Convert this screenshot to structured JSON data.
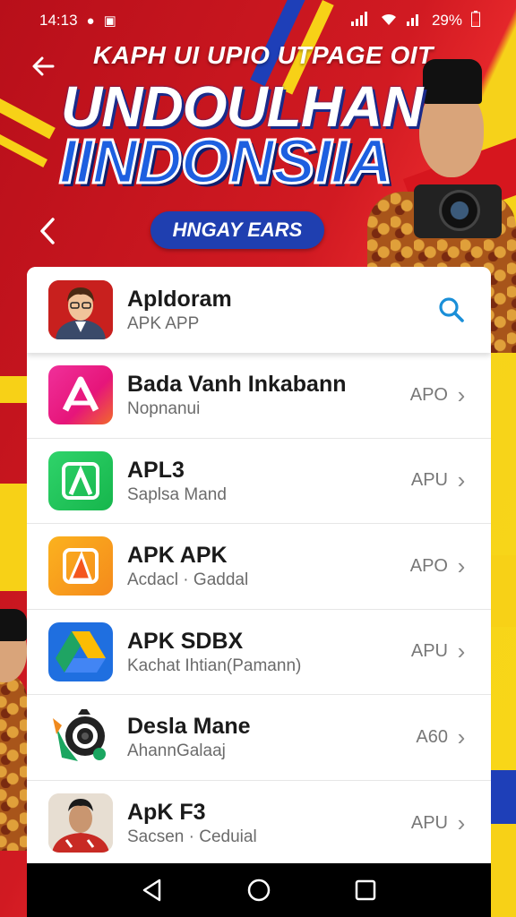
{
  "status_bar": {
    "time": "14:13",
    "battery": "29%"
  },
  "banner": {
    "subtitle_text": "KAPH UI UPIO UTPAGE OIT",
    "headline_line1": "UNDOULHAN",
    "headline_line2": "IINDONSIIA",
    "pill_text": "HNGAY EARS"
  },
  "header_item": {
    "title": "Apldoram",
    "subtitle": "APK APP"
  },
  "apps": [
    {
      "title": "Bada Vanh Inkabann",
      "subtitle": "Nopnanui",
      "tag": "APO",
      "icon": "magenta-a-icon"
    },
    {
      "title": "APL3",
      "subtitle": "Saplsa Mand",
      "tag": "APU",
      "icon": "green-a-icon"
    },
    {
      "title": "APK APK",
      "subtitle": "Acdacl · Gaddal",
      "tag": "APO",
      "icon": "orange-a-icon"
    },
    {
      "title": "APK SDBX",
      "subtitle": "Kachat Ihtian(Pamann)",
      "tag": "APU",
      "icon": "drive-triangle-icon"
    },
    {
      "title": "Desla Mane",
      "subtitle": "AhannGalaaj",
      "tag": "A60",
      "icon": "gear-camera-icon"
    },
    {
      "title": "ApK F3",
      "subtitle": "Sacsen · Ceduial",
      "tag": "APU",
      "icon": "portrait-icon"
    }
  ],
  "colors": {
    "banner_red": "#c8141e",
    "banner_yellow": "#f7d117",
    "banner_blue": "#1f3fb0",
    "search_accent": "#1a8fd8"
  }
}
